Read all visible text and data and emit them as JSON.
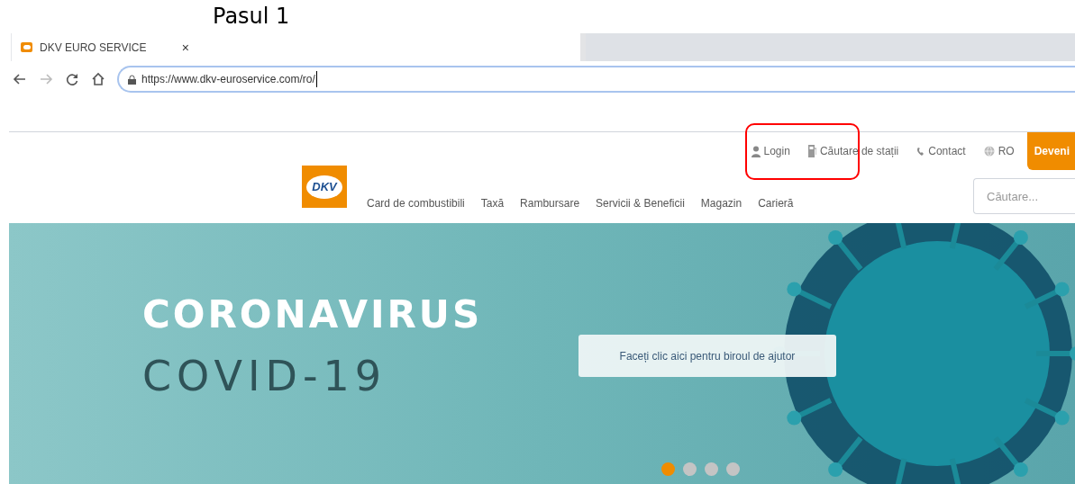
{
  "annotation": {
    "caption": "Pasul 1",
    "highlight": true
  },
  "browser": {
    "tab": {
      "title": "DKV EURO SERVICE",
      "close": "×"
    },
    "url": "https://www.dkv-euroservice.com/ro/"
  },
  "utility_nav": [
    {
      "kind": "login",
      "label": "Login"
    },
    {
      "kind": "station",
      "label": "Căutare de stații"
    },
    {
      "kind": "contact",
      "label": "Contact"
    },
    {
      "kind": "language",
      "label": "RO"
    }
  ],
  "cta": "Deveni",
  "logo": "DKV",
  "main_nav": [
    "Card de combustibili",
    "Taxă",
    "Rambursare",
    "Servicii & Beneficii",
    "Magazin",
    "Carieră"
  ],
  "search": {
    "placeholder": "Căutare..."
  },
  "hero": {
    "title": "CORONAVIRUS",
    "subtitle": "COVID-19",
    "button": "Faceți clic aici pentru biroul de ajutor",
    "dots": [
      {
        "selected": true
      },
      {
        "selected": false
      },
      {
        "selected": false
      },
      {
        "selected": false
      }
    ]
  }
}
